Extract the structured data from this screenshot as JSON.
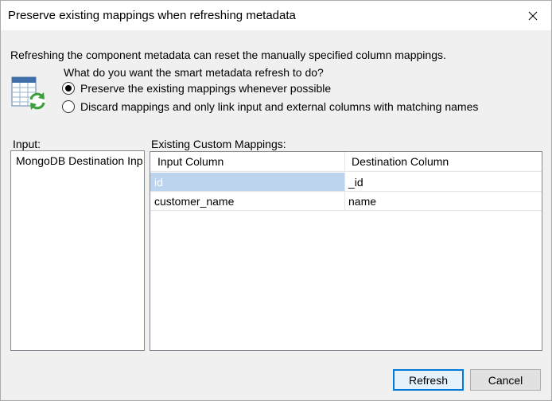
{
  "window": {
    "title": "Preserve existing mappings when refreshing metadata"
  },
  "message": {
    "description": "Refreshing the component metadata can reset the manually specified column mappings.",
    "question": "What do you want the smart metadata refresh to do?"
  },
  "options": [
    {
      "label": "Preserve the existing mappings whenever possible",
      "selected": true
    },
    {
      "label": "Discard mappings and only link input and external columns with matching names",
      "selected": false
    }
  ],
  "input_panel": {
    "label": "Input:",
    "items": [
      "MongoDB Destination Inp"
    ]
  },
  "mappings_panel": {
    "label": "Existing Custom Mappings:",
    "columns": [
      "Input Column",
      "Destination Column"
    ],
    "rows": [
      {
        "input": "id",
        "destination": "_id",
        "selected": true
      },
      {
        "input": "customer_name",
        "destination": "name",
        "selected": false
      }
    ]
  },
  "buttons": {
    "refresh": "Refresh",
    "cancel": "Cancel"
  },
  "colors": {
    "selection": "#bcd4ee",
    "default_button_border": "#0078d7",
    "window_background": "#f0f0f0"
  },
  "icons": {
    "dialog": "table-refresh-icon",
    "close": "close-icon"
  }
}
